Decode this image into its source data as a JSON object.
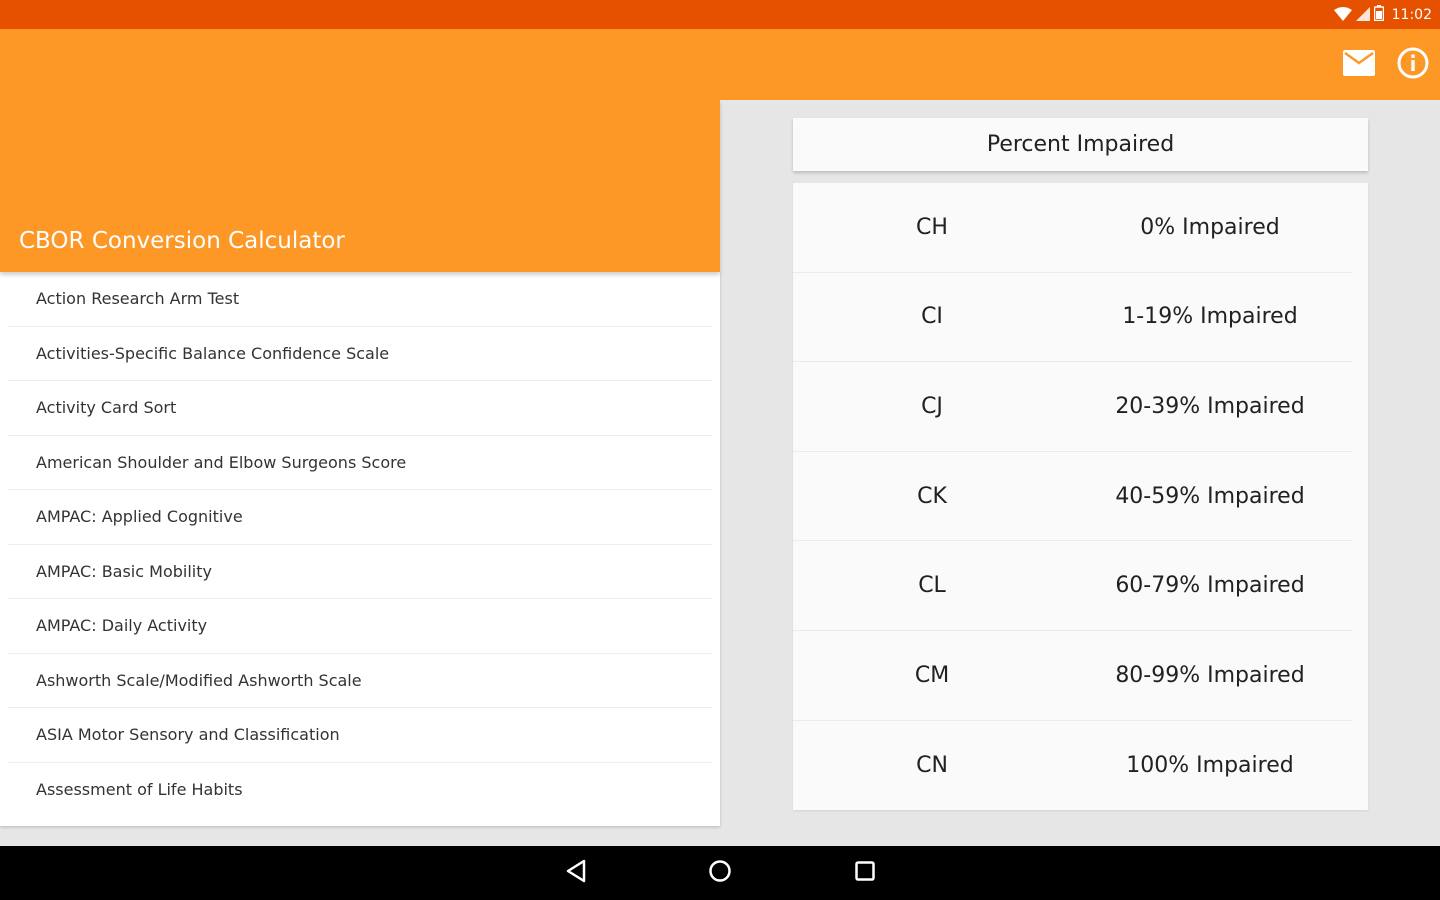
{
  "status_bar": {
    "time": "11:02",
    "icons": [
      "wifi-icon",
      "cell-signal-icon",
      "battery-icon"
    ],
    "color": "#e65100"
  },
  "app_bar": {
    "title": "CBOR Conversion Calculator",
    "color": "#fd9826",
    "actions": [
      "mail-icon",
      "info-icon"
    ]
  },
  "sidebar": {
    "items": [
      {
        "label": "Action Research Arm Test"
      },
      {
        "label": "Activities-Specific Balance Confidence Scale"
      },
      {
        "label": "Activity Card Sort"
      },
      {
        "label": "American Shoulder and Elbow Surgeons Score"
      },
      {
        "label": "AMPAC: Applied Cognitive"
      },
      {
        "label": "AMPAC: Basic Mobility"
      },
      {
        "label": "AMPAC: Daily Activity"
      },
      {
        "label": "Ashworth Scale/Modified Ashworth Scale"
      },
      {
        "label": "ASIA Motor Sensory and Classification"
      },
      {
        "label": "Assessment of Life Habits"
      }
    ]
  },
  "results": {
    "header": "Percent Impaired",
    "rows": [
      {
        "code": "CH",
        "description": "0% Impaired"
      },
      {
        "code": "CI",
        "description": "1-19% Impaired"
      },
      {
        "code": "CJ",
        "description": "20-39% Impaired"
      },
      {
        "code": "CK",
        "description": "40-59% Impaired"
      },
      {
        "code": "CL",
        "description": "60-79% Impaired"
      },
      {
        "code": "CM",
        "description": "80-99% Impaired"
      },
      {
        "code": "CN",
        "description": "100% Impaired"
      }
    ]
  },
  "nav_bar": {
    "buttons": [
      "back-icon",
      "home-icon",
      "recents-icon"
    ]
  }
}
